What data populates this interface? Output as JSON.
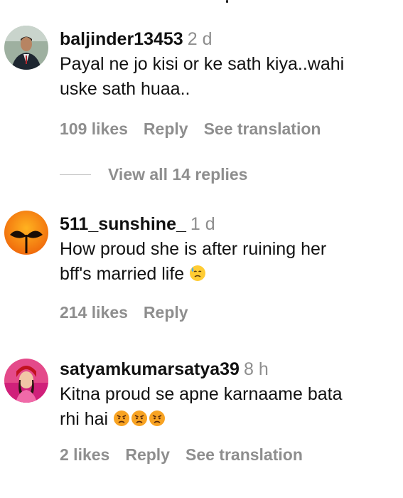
{
  "comments": [
    {
      "username": "baljinder13453",
      "time": "2 d",
      "lines": [
        "Payal ne jo kisi or ke sath kiya..wahi",
        "uske sath huaa.."
      ],
      "likes": "109 likes",
      "reply": "Reply",
      "translate": "See translation",
      "avatar_icon": "man-in-suit-photo"
    },
    {
      "username": "511_sunshine_",
      "time": "1 d",
      "lines": [
        "How proud she is after ruining her",
        "bff's married life"
      ],
      "emoji_icon": "sad-sweat-face-emoji",
      "likes": "214 likes",
      "reply": "Reply",
      "avatar_icon": "sunset-sprout-photo"
    },
    {
      "username": "satyamkumarsatya39",
      "time": "8 h",
      "lines": [
        "Kitna proud se apne karnaame bata",
        "rhi hai"
      ],
      "emoji_icon": "angry-face-emoji",
      "likes": "2 likes",
      "reply": "Reply",
      "translate": "See translation",
      "avatar_icon": "woman-red-hat-photo"
    }
  ],
  "view_replies": "View all 14 replies",
  "colors": {
    "text": "#111111",
    "muted": "#8e8e8e",
    "divider": "#c7c7c7"
  }
}
